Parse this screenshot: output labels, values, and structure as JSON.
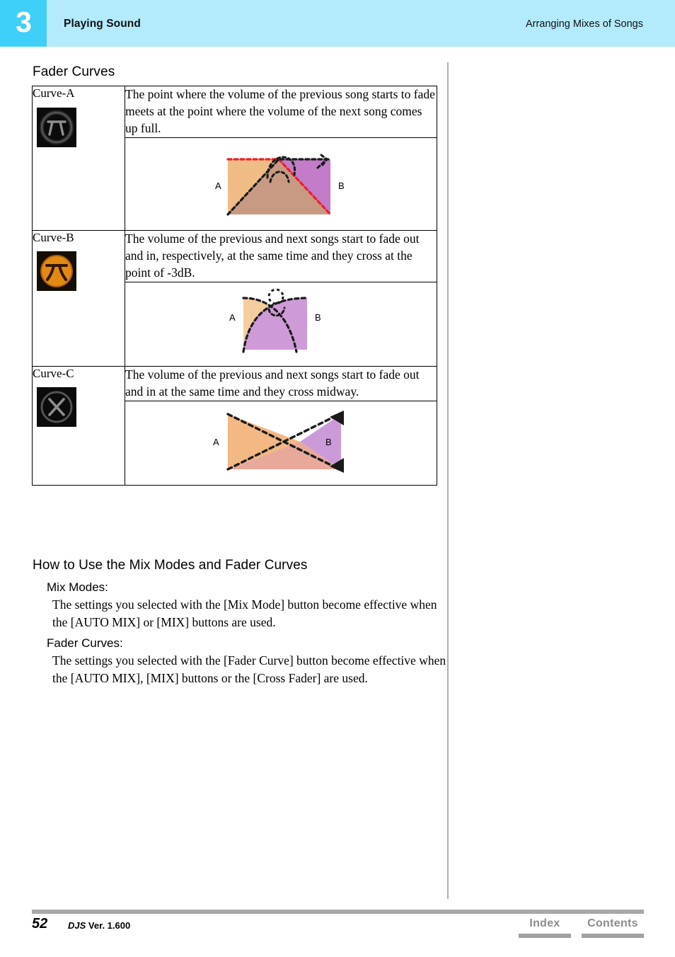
{
  "header": {
    "chapter_number": "3",
    "chapter_title": "Playing Sound",
    "section_title": "Arranging Mixes of Songs",
    "band_color": "#b3eafc",
    "chapter_box_color": "#3fd0fa"
  },
  "sections": {
    "fader_curves_title": "Fader Curves",
    "howto_title": "How to Use the Mix Modes and Fader Curves"
  },
  "table": {
    "rows": [
      {
        "label": "Curve-A",
        "icon": "curve-a-pi-icon",
        "description": "The point where the volume of the previous song starts to fade meets at the point where the volume of the next song comes up full.",
        "diagram": {
          "type": "fader-curve-a",
          "label_left": "A",
          "label_right": "B",
          "colors": {
            "song_a": "#f0bc85",
            "song_b": "#c27cc8",
            "overlap": "#c89a84",
            "curve_a_line": "#e8212a",
            "curve_b_line": "#1a1a1a"
          }
        }
      },
      {
        "label": "Curve-B",
        "icon": "curve-b-arch-icon",
        "description": "The volume of the previous and next songs start to fade out and in, respectively, at the same time and they cross at the point of -3dB.",
        "diagram": {
          "type": "fader-curve-b",
          "label_left": "A",
          "label_right": "B",
          "colors": {
            "song_a": "#f5ceA0",
            "song_b": "#cf9ad8",
            "curve_line": "#1a1a1a"
          }
        }
      },
      {
        "label": "Curve-C",
        "icon": "curve-c-x-icon",
        "description": "The volume of the previous and next songs start to fade out and in at the same time and they cross midway.",
        "diagram": {
          "type": "fader-curve-c",
          "label_left": "A",
          "label_right": "B",
          "colors": {
            "song_a": "#f3b883",
            "song_b": "#cb9ad9",
            "overlap": "#e8a99b",
            "curve_line": "#1a1a1a"
          }
        }
      }
    ]
  },
  "howto": {
    "mix_modes_heading": "Mix Modes:",
    "mix_modes_body": "The settings you selected with the [Mix Mode] button become effective when the [AUTO MIX] or [MIX] buttons are used.",
    "fader_curves_heading": "Fader Curves:",
    "fader_curves_body": "The settings you selected with the [Fader Curve] button become effective when the [AUTO MIX], [MIX] buttons or the [Cross Fader] are used."
  },
  "footer": {
    "page_number": "52",
    "doc_name": "DJS",
    "doc_version": "Ver. 1.600",
    "index_label": "Index",
    "contents_label": "Contents",
    "rule_color": "#a8a8a8",
    "button_color": "#8c8c8c"
  }
}
